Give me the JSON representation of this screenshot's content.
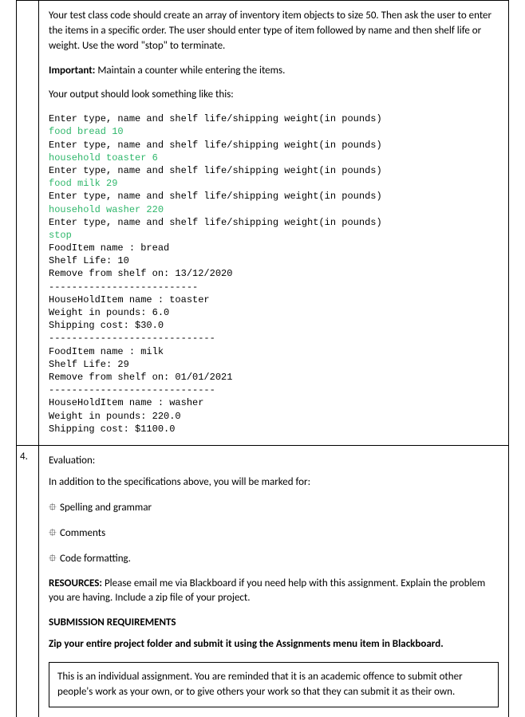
{
  "row1": {
    "num": "",
    "intro": "Your test class code should create an array of inventory item objects to size 50. Then ask the user to enter the items in a specific order. The user should enter type of item followed by name and then shelf life or weight. Use the word \"stop\" to terminate.",
    "important_label": "Important:",
    "important_text": " Maintain a counter while entering the items.",
    "output_lead": "Your output should look something like this:",
    "code": {
      "prompt": "Enter type, name and shelf life/shipping weight(in pounds)",
      "inputs": [
        "food bread 10",
        "household toaster 6",
        "food milk 29",
        "household washer 220",
        "stop"
      ],
      "dash_short": "--------------------------",
      "dash_long": "-----------------------------",
      "out": [
        "FoodItem name : bread",
        "Shelf Life: 10",
        "Remove from shelf on: 13/12/2020",
        "HouseHoldItem name : toaster",
        "Weight in pounds: 6.0",
        "Shipping cost: $30.0",
        "FoodItem name : milk",
        "Shelf Life: 29",
        "Remove from shelf on: 01/01/2021",
        "HouseHoldItem name : washer",
        "Weight in pounds: 220.0",
        "Shipping cost: $1100.0"
      ]
    }
  },
  "row2": {
    "num": "4.",
    "eval_heading": "Evaluation:",
    "eval_lead": "In addition to the specifications above, you will be marked for:",
    "bullet_glyph": "⯐",
    "bullets": [
      "Spelling and grammar",
      "Comments",
      "Code formatting."
    ],
    "resources_label": "RESOURCES:",
    "resources_text": " Please email me via Blackboard if you need help with this assignment. Explain the problem you are having. Include a zip file of your project.",
    "submission_heading": "SUBMISSION REQUIREMENTS",
    "submission_text": "Zip your entire project folder and submit it using the Assignments menu item in Blackboard.",
    "notice": "This is an individual assignment. You are reminded that it is an academic offence to submit other people's work as your own, or to give others your work so that they can submit it as their own."
  }
}
